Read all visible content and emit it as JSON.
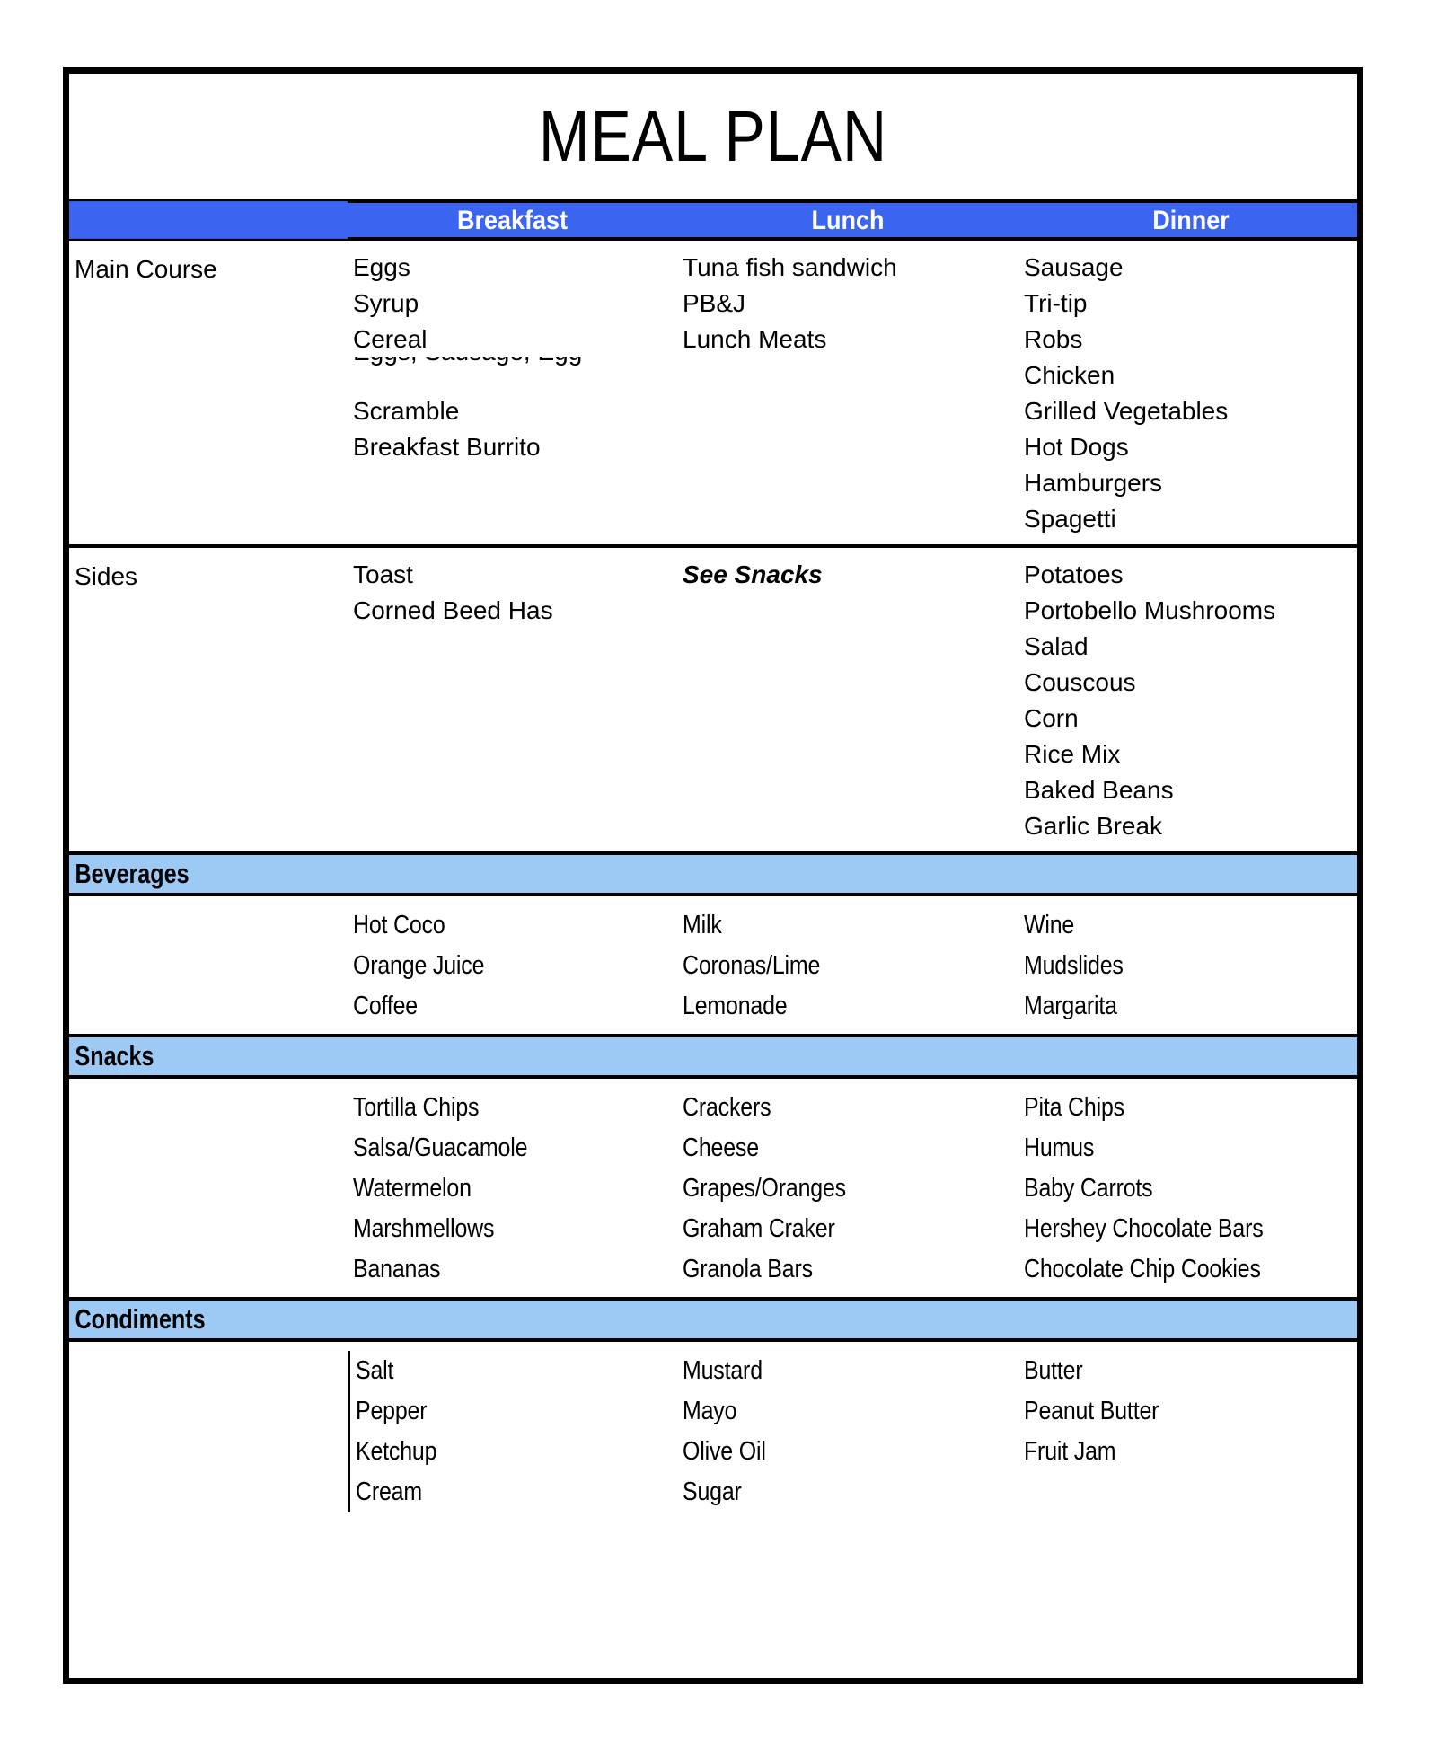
{
  "document": {
    "title": "MEAL PLAN",
    "colors": {
      "header_blue": "#3b64f0",
      "section_blue": "#9dc9f5",
      "border": "#000000",
      "text": "#000000",
      "header_text": "#ffffff"
    }
  },
  "columns": {
    "row_label": "",
    "breakfast": "Breakfast",
    "lunch": "Lunch",
    "dinner": "Dinner"
  },
  "sections": {
    "main_course": {
      "label": "Main Course",
      "breakfast": [
        "Eggs",
        "Syrup",
        "Cereal",
        "Scramble",
        "Breakfast Burrito"
      ],
      "breakfast_clipped": "Eggs, Sausage, Egg",
      "lunch": [
        "Tuna fish sandwich",
        "PB&J",
        "Lunch Meats"
      ],
      "dinner": [
        "Sausage",
        "Tri-tip",
        "Robs",
        "Chicken",
        "Grilled Vegetables",
        "Hot Dogs",
        "Hamburgers",
        "Spagetti"
      ]
    },
    "sides": {
      "label": "Sides",
      "breakfast": [
        "Toast",
        "Corned Beed Has"
      ],
      "lunch_note": "See Snacks",
      "dinner": [
        "Potatoes",
        "Portobello Mushrooms",
        "Salad",
        "Couscous",
        "Corn",
        "Rice Mix",
        "Baked Beans",
        "Garlic Break"
      ]
    },
    "beverages": {
      "label": "Beverages",
      "breakfast": [
        "Hot Coco",
        "Orange Juice",
        "Coffee"
      ],
      "lunch": [
        "Milk",
        "Coronas/Lime",
        "Lemonade"
      ],
      "dinner": [
        "Wine",
        "Mudslides",
        "Margarita"
      ]
    },
    "snacks": {
      "label": "Snacks",
      "breakfast": [
        "Tortilla Chips",
        "Salsa/Guacamole",
        "Watermelon",
        "Marshmellows",
        "Bananas"
      ],
      "lunch": [
        "Crackers",
        "Cheese",
        "Grapes/Oranges",
        "Graham Craker",
        "Granola Bars"
      ],
      "dinner": [
        "Pita Chips",
        "Humus",
        "Baby Carrots",
        "Hershey Chocolate Bars",
        "Chocolate Chip Cookies"
      ]
    },
    "condiments": {
      "label": "Condiments",
      "breakfast": [
        "Salt",
        "Pepper",
        "Ketchup",
        "Cream"
      ],
      "lunch": [
        "Mustard",
        "Mayo",
        "Olive Oil",
        "Sugar"
      ],
      "dinner": [
        "Butter",
        "Peanut Butter",
        "Fruit Jam"
      ]
    }
  }
}
